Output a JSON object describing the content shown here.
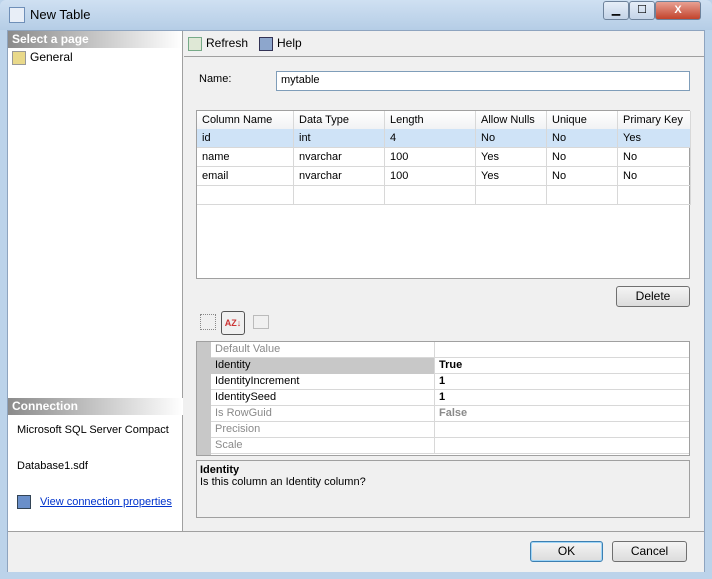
{
  "window": {
    "title": "New Table",
    "minimize": "▁",
    "maximize": "☐",
    "close": "X"
  },
  "left": {
    "select_header": "Select a page",
    "pages": [
      "General"
    ],
    "connection_header": "Connection",
    "server": "Microsoft SQL Server Compact",
    "database": "Database1.sdf",
    "view_link": "View connection properties"
  },
  "toolbar": {
    "refresh": "Refresh",
    "help": "Help"
  },
  "form": {
    "name_label": "Name:",
    "name_value": "mytable"
  },
  "grid": {
    "headers": [
      "Column Name",
      "Data Type",
      "Length",
      "Allow Nulls",
      "Unique",
      "Primary Key"
    ],
    "rows": [
      [
        "id",
        "int",
        "4",
        "No",
        "No",
        "Yes"
      ],
      [
        "name",
        "nvarchar",
        "100",
        "Yes",
        "No",
        "No"
      ],
      [
        "email",
        "nvarchar",
        "100",
        "Yes",
        "No",
        "No"
      ]
    ]
  },
  "delete": "Delete",
  "props": [
    {
      "name": "Default Value",
      "value": ""
    },
    {
      "name": "Identity",
      "value": "True"
    },
    {
      "name": "IdentityIncrement",
      "value": "1"
    },
    {
      "name": "IdentitySeed",
      "value": "1"
    },
    {
      "name": "Is RowGuid",
      "value": "False"
    },
    {
      "name": "Precision",
      "value": ""
    },
    {
      "name": "Scale",
      "value": ""
    }
  ],
  "description": {
    "title": "Identity",
    "text": "Is this column an Identity column?"
  },
  "buttons": {
    "ok": "OK",
    "cancel": "Cancel"
  }
}
